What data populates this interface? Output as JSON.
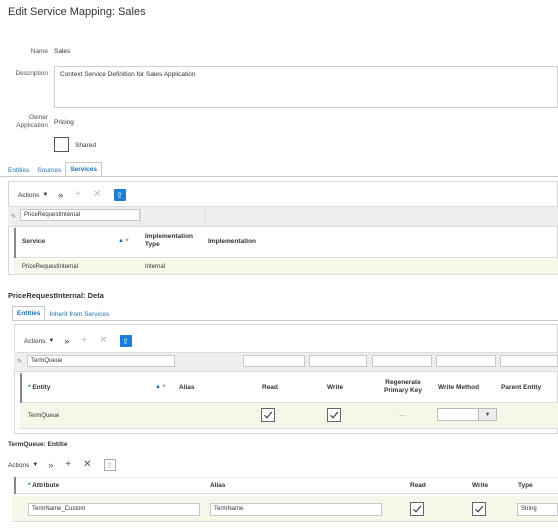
{
  "page": {
    "title": "Edit Service Mapping: Sales"
  },
  "form": {
    "name_label": "Name",
    "name_value": "Sales",
    "description_label": "Description",
    "description_value": "Context Service Definition for Sales Application",
    "owner_label_line1": "Owner",
    "owner_label_line2": "Application",
    "owner_value": "Pricing",
    "shared_label": "Shared"
  },
  "tabs": [
    {
      "label": "Entities"
    },
    {
      "label": "Sources"
    },
    {
      "label": "Services",
      "active": true
    }
  ],
  "services_panel": {
    "actions_label": "Actions",
    "filter_value": "PriceRequestInternal",
    "columns": {
      "service": "Service",
      "implementation_type_line1": "Implementation",
      "implementation_type_line2": "Type",
      "implementation": "Implementation"
    },
    "row": {
      "service": "PriceRequestInternal",
      "implementation_type": "Internal",
      "implementation": ""
    }
  },
  "detail": {
    "title": "PriceRequestInternal: Deta",
    "tabs": [
      {
        "label": "Entities",
        "active": true
      },
      {
        "label": "Inherit from Services"
      }
    ],
    "actions_label": "Actions",
    "filter_value": "TermQueue",
    "columns": {
      "entity": "Entity",
      "alias": "Alias",
      "read": "Read",
      "write": "Write",
      "regen_line1": "Regenerate",
      "regen_line2": "Primary Key",
      "write_method": "Write Method",
      "parent_entity": "Parent Entity"
    },
    "row": {
      "entity": "TermQueue",
      "read": true,
      "write": true,
      "regen": "—"
    }
  },
  "entity_attrs": {
    "title": "TermQueue: Entitie",
    "actions_label": "Actions",
    "columns": {
      "attribute": "Attribute",
      "alias": "Alias",
      "read": "Read",
      "write": "Write",
      "type": "Type"
    },
    "row": {
      "attribute": "TermName_Custom",
      "alias": "TermName",
      "read": true,
      "write": true,
      "type": "String"
    }
  },
  "colors": {
    "accent": "#1a70b5",
    "toolbar_blue": "#1a7dd6",
    "selected_row": "#f5f7e9"
  }
}
